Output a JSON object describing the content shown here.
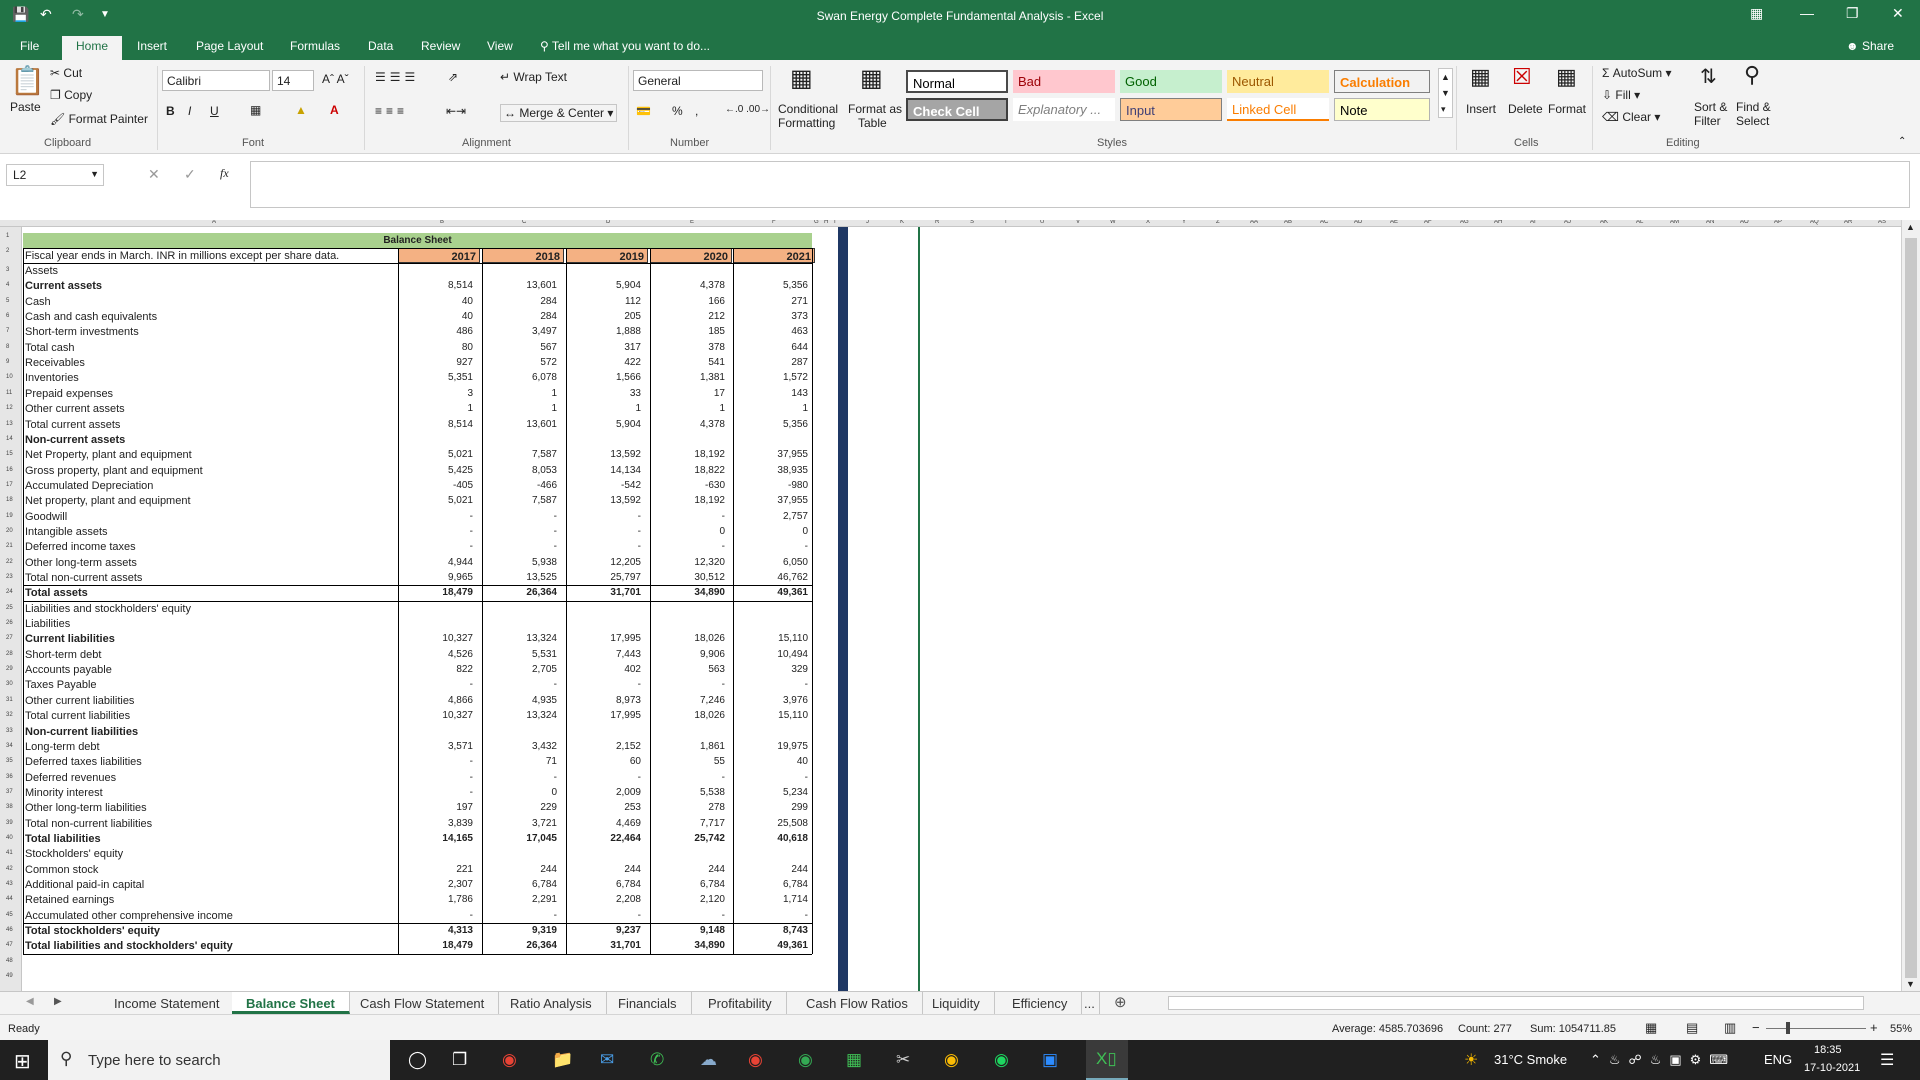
{
  "app": {
    "title": "Swan Energy Complete Fundamental Analysis - Excel"
  },
  "tabs": [
    "File",
    "Home",
    "Insert",
    "Page Layout",
    "Formulas",
    "Data",
    "Review",
    "View"
  ],
  "active_tab": "Home",
  "tell_me": "Tell me what you want to do...",
  "share": "Share",
  "ribbon": {
    "clipboard": {
      "paste": "Paste",
      "cut": "Cut",
      "copy": "Copy",
      "format_painter": "Format Painter",
      "group": "Clipboard"
    },
    "font": {
      "name": "Calibri",
      "size": "14",
      "bold": "B",
      "italic": "I",
      "underline": "U",
      "group": "Font"
    },
    "alignment": {
      "wrap": "Wrap Text",
      "merge": "Merge & Center",
      "group": "Alignment"
    },
    "number": {
      "format": "General",
      "percent": "%",
      "comma": ",",
      "group": "Number"
    },
    "styles": {
      "cond_fmt": "Conditional",
      "cond_fmt2": "Formatting",
      "fmt_table": "Format as",
      "fmt_table2": "Table",
      "cells": [
        {
          "label": "Normal",
          "bg": "#ffffff",
          "fg": "#000000"
        },
        {
          "label": "Bad",
          "bg": "#ffc7ce",
          "fg": "#9c0006"
        },
        {
          "label": "Good",
          "bg": "#c6efce",
          "fg": "#006100"
        },
        {
          "label": "Neutral",
          "bg": "#ffeb9c",
          "fg": "#9c5700"
        },
        {
          "label": "Calculation",
          "bg": "#f2f2f2",
          "fg": "#fa7d00"
        },
        {
          "label": "Check Cell",
          "bg": "#a5a5a5",
          "fg": "#ffffff"
        },
        {
          "label": "Explanatory ...",
          "bg": "#ffffff",
          "fg": "#7f7f7f"
        },
        {
          "label": "Input",
          "bg": "#ffcc99",
          "fg": "#3f3f76"
        },
        {
          "label": "Linked Cell",
          "bg": "#ffffff",
          "fg": "#fa7d00"
        },
        {
          "label": "Note",
          "bg": "#ffffcc",
          "fg": "#000000"
        }
      ],
      "group": "Styles"
    },
    "cells": {
      "insert": "Insert",
      "delete": "Delete",
      "format": "Format",
      "group": "Cells"
    },
    "editing": {
      "autosum": "AutoSum",
      "fill": "Fill",
      "clear": "Clear",
      "sort": "Sort &",
      "sort2": "Filter",
      "find": "Find &",
      "find2": "Select",
      "group": "Editing"
    }
  },
  "name_box": "L2",
  "fx": "fx",
  "sheet": {
    "band_title": "Balance Sheet",
    "header_label": "Fiscal year ends in March. INR in millions except per share data.",
    "years": [
      "2017",
      "2018",
      "2019",
      "2020",
      "2021"
    ],
    "rows": [
      {
        "label": "Assets",
        "bold": false,
        "values": [
          "",
          "",
          "",
          "",
          ""
        ]
      },
      {
        "label": "Current assets",
        "bold": true,
        "values": [
          "8,514",
          "13,601",
          "5,904",
          "4,378",
          "5,356"
        ]
      },
      {
        "label": "Cash",
        "bold": false,
        "values": [
          "40",
          "284",
          "112",
          "166",
          "271"
        ]
      },
      {
        "label": "Cash and cash equivalents",
        "bold": false,
        "values": [
          "40",
          "284",
          "205",
          "212",
          "373"
        ]
      },
      {
        "label": "Short-term investments",
        "bold": false,
        "values": [
          "486",
          "3,497",
          "1,888",
          "185",
          "463"
        ]
      },
      {
        "label": "Total cash",
        "bold": false,
        "values": [
          "80",
          "567",
          "317",
          "378",
          "644"
        ]
      },
      {
        "label": "Receivables",
        "bold": false,
        "values": [
          "927",
          "572",
          "422",
          "541",
          "287"
        ]
      },
      {
        "label": "Inventories",
        "bold": false,
        "values": [
          "5,351",
          "6,078",
          "1,566",
          "1,381",
          "1,572"
        ]
      },
      {
        "label": "Prepaid expenses",
        "bold": false,
        "values": [
          "3",
          "1",
          "33",
          "17",
          "143"
        ]
      },
      {
        "label": "Other current assets",
        "bold": false,
        "values": [
          "1",
          "1",
          "1",
          "1",
          "1"
        ]
      },
      {
        "label": "Total current assets",
        "bold": false,
        "values": [
          "8,514",
          "13,601",
          "5,904",
          "4,378",
          "5,356"
        ]
      },
      {
        "label": "Non-current assets",
        "bold": true,
        "values": [
          "",
          "",
          "",
          "",
          ""
        ]
      },
      {
        "label": "Net Property, plant and equipment",
        "bold": false,
        "values": [
          "5,021",
          "7,587",
          "13,592",
          "18,192",
          "37,955"
        ]
      },
      {
        "label": "Gross property, plant and equipment",
        "bold": false,
        "values": [
          "5,425",
          "8,053",
          "14,134",
          "18,822",
          "38,935"
        ]
      },
      {
        "label": "Accumulated Depreciation",
        "bold": false,
        "values": [
          "-405",
          "-466",
          "-542",
          "-630",
          "-980"
        ]
      },
      {
        "label": "Net property, plant and equipment",
        "bold": false,
        "values": [
          "5,021",
          "7,587",
          "13,592",
          "18,192",
          "37,955"
        ]
      },
      {
        "label": "Goodwill",
        "bold": false,
        "values": [
          "-",
          "-",
          "-",
          "-",
          "2,757"
        ]
      },
      {
        "label": "Intangible assets",
        "bold": false,
        "values": [
          "-",
          "-",
          "-",
          "0",
          "0"
        ]
      },
      {
        "label": "Deferred income taxes",
        "bold": false,
        "values": [
          "-",
          "-",
          "-",
          "-",
          "-"
        ]
      },
      {
        "label": "Other long-term assets",
        "bold": false,
        "values": [
          "4,944",
          "5,938",
          "12,205",
          "12,320",
          "6,050"
        ]
      },
      {
        "label": "Total non-current assets",
        "bold": false,
        "values": [
          "9,965",
          "13,525",
          "25,797",
          "30,512",
          "46,762"
        ]
      },
      {
        "label": "Total assets",
        "bold": true,
        "values": [
          "18,479",
          "26,364",
          "31,701",
          "34,890",
          "49,361"
        ]
      },
      {
        "label": "Liabilities and stockholders' equity",
        "bold": false,
        "values": [
          "",
          "",
          "",
          "",
          ""
        ]
      },
      {
        "label": "Liabilities",
        "bold": false,
        "values": [
          "",
          "",
          "",
          "",
          ""
        ]
      },
      {
        "label": "Current liabilities",
        "bold": true,
        "values": [
          "10,327",
          "13,324",
          "17,995",
          "18,026",
          "15,110"
        ]
      },
      {
        "label": "Short-term debt",
        "bold": false,
        "values": [
          "4,526",
          "5,531",
          "7,443",
          "9,906",
          "10,494"
        ]
      },
      {
        "label": "Accounts payable",
        "bold": false,
        "values": [
          "822",
          "2,705",
          "402",
          "563",
          "329"
        ]
      },
      {
        "label": "Taxes Payable",
        "bold": false,
        "values": [
          "-",
          "-",
          "-",
          "-",
          "-"
        ]
      },
      {
        "label": "Other current liabilities",
        "bold": false,
        "values": [
          "4,866",
          "4,935",
          "8,973",
          "7,246",
          "3,976"
        ]
      },
      {
        "label": "Total current liabilities",
        "bold": false,
        "values": [
          "10,327",
          "13,324",
          "17,995",
          "18,026",
          "15,110"
        ]
      },
      {
        "label": "Non-current liabilities",
        "bold": true,
        "values": [
          "",
          "",
          "",
          "",
          ""
        ]
      },
      {
        "label": "Long-term debt",
        "bold": false,
        "values": [
          "3,571",
          "3,432",
          "2,152",
          "1,861",
          "19,975"
        ]
      },
      {
        "label": "Deferred taxes liabilities",
        "bold": false,
        "values": [
          "-",
          "71",
          "60",
          "55",
          "40"
        ]
      },
      {
        "label": "Deferred revenues",
        "bold": false,
        "values": [
          "-",
          "-",
          "-",
          "-",
          "-"
        ]
      },
      {
        "label": "Minority interest",
        "bold": false,
        "values": [
          "-",
          "0",
          "2,009",
          "5,538",
          "5,234"
        ]
      },
      {
        "label": "Other long-term liabilities",
        "bold": false,
        "values": [
          "197",
          "229",
          "253",
          "278",
          "299"
        ]
      },
      {
        "label": "Total non-current liabilities",
        "bold": false,
        "values": [
          "3,839",
          "3,721",
          "4,469",
          "7,717",
          "25,508"
        ]
      },
      {
        "label": "Total liabilities",
        "bold": true,
        "values": [
          "14,165",
          "17,045",
          "22,464",
          "25,742",
          "40,618"
        ]
      },
      {
        "label": "Stockholders' equity",
        "bold": false,
        "values": [
          "",
          "",
          "",
          "",
          ""
        ]
      },
      {
        "label": "Common stock",
        "bold": false,
        "values": [
          "221",
          "244",
          "244",
          "244",
          "244"
        ]
      },
      {
        "label": "Additional paid-in capital",
        "bold": false,
        "values": [
          "2,307",
          "6,784",
          "6,784",
          "6,784",
          "6,784"
        ]
      },
      {
        "label": "Retained earnings",
        "bold": false,
        "values": [
          "1,786",
          "2,291",
          "2,208",
          "2,120",
          "1,714"
        ]
      },
      {
        "label": "Accumulated other comprehensive income",
        "bold": false,
        "values": [
          "-",
          "-",
          "-",
          "-",
          "-"
        ]
      },
      {
        "label": "Total stockholders' equity",
        "bold": true,
        "values": [
          "4,313",
          "9,319",
          "9,237",
          "9,148",
          "8,743"
        ]
      },
      {
        "label": "Total liabilities and stockholders' equity",
        "bold": true,
        "values": [
          "18,479",
          "26,364",
          "31,701",
          "34,890",
          "49,361"
        ]
      }
    ]
  },
  "columns": [
    "A",
    "B",
    "C",
    "D",
    "E",
    "F",
    "G",
    "H",
    "I",
    "J",
    "K",
    "R",
    "S",
    "T",
    "U",
    "V",
    "W",
    "X",
    "Y",
    "Z",
    "AA",
    "AB",
    "AC",
    "AD",
    "AE",
    "AF",
    "AG",
    "AH",
    "AI",
    "AJ",
    "AK",
    "AL",
    "AM",
    "AN",
    "AO",
    "AP",
    "AQ",
    "AR",
    "AS"
  ],
  "sheet_tabs": [
    "Income Statement",
    "Balance Sheet",
    "Cash Flow Statement",
    "Ratio Analysis",
    "Financials",
    "Profitability",
    "Cash Flow Ratios",
    "Liquidity",
    "Efficiency",
    "..."
  ],
  "active_sheet": "Balance Sheet",
  "status": {
    "ready": "Ready",
    "average": "Average: 4585.703696",
    "count": "Count: 277",
    "sum": "Sum: 1054711.85",
    "zoom": "55%"
  },
  "taskbar": {
    "search": "Type here to search",
    "weather": "31°C  Smoke",
    "lang": "ENG",
    "time": "18:35",
    "date": "17-10-2021"
  }
}
